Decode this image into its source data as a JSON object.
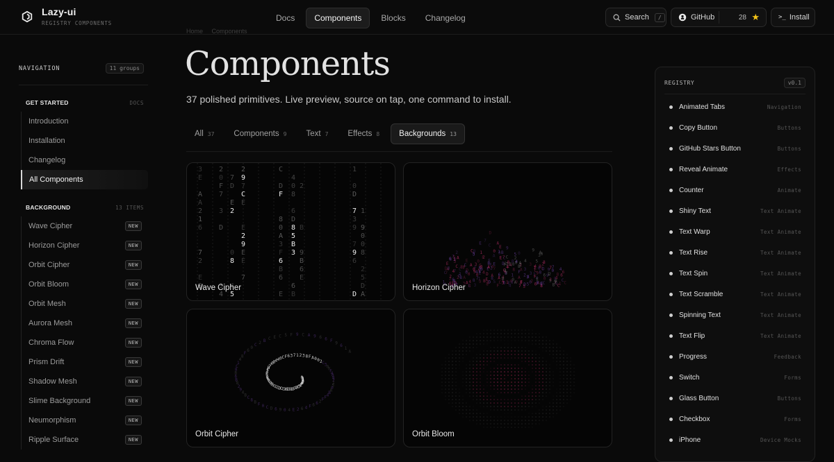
{
  "brand": {
    "name": "Lazy-ui",
    "sub": "REGISTRY COMPONENTS"
  },
  "nav": [
    "Docs",
    "Components",
    "Blocks",
    "Changelog"
  ],
  "header": {
    "search": "Search",
    "search_key": "/",
    "github": "GitHub",
    "stars": "28",
    "install": "Install"
  },
  "sidebar": {
    "title": "NAVIGATION",
    "badge": "11 groups",
    "get_started": {
      "title": "GET STARTED",
      "meta": "DOCS",
      "items": [
        "Introduction",
        "Installation",
        "Changelog",
        "All Components"
      ]
    },
    "background": {
      "title": "BACKGROUND",
      "meta": "13 ITEMS",
      "items": [
        "Wave Cipher",
        "Horizon Cipher",
        "Orbit Cipher",
        "Orbit Bloom",
        "Orbit Mesh",
        "Aurora Mesh",
        "Chroma Flow",
        "Prism Drift",
        "Shadow Mesh",
        "Slime Background",
        "Neumorphism",
        "Ripple Surface"
      ],
      "badge": "NEW"
    }
  },
  "breadcrumb": [
    "Home",
    "Components"
  ],
  "page": {
    "title": "Components",
    "subtitle": "37 polished primitives. Live preview, source on tap, one command to install."
  },
  "tabs": [
    {
      "label": "All",
      "count": "37"
    },
    {
      "label": "Components",
      "count": "9"
    },
    {
      "label": "Text",
      "count": "7"
    },
    {
      "label": "Effects",
      "count": "8"
    },
    {
      "label": "Backgrounds",
      "count": "13"
    }
  ],
  "cards": [
    "Wave Cipher",
    "Horizon Cipher",
    "Orbit Cipher",
    "Orbit Bloom"
  ],
  "registry": {
    "title": "REGISTRY",
    "version": "v0.1",
    "items": [
      {
        "name": "Animated Tabs",
        "cat": "Navigation"
      },
      {
        "name": "Copy Button",
        "cat": "Buttons"
      },
      {
        "name": "GitHub Stars Button",
        "cat": "Buttons"
      },
      {
        "name": "Reveal Animate",
        "cat": "Effects"
      },
      {
        "name": "Counter",
        "cat": "Animate"
      },
      {
        "name": "Shiny Text",
        "cat": "Text Animate"
      },
      {
        "name": "Text Warp",
        "cat": "Text Animate"
      },
      {
        "name": "Text Rise",
        "cat": "Text Animate"
      },
      {
        "name": "Text Spin",
        "cat": "Text Animate"
      },
      {
        "name": "Text Scramble",
        "cat": "Text Animate"
      },
      {
        "name": "Spinning Text",
        "cat": "Text Animate"
      },
      {
        "name": "Text Flip",
        "cat": "Text Animate"
      },
      {
        "name": "Progress",
        "cat": "Feedback"
      },
      {
        "name": "Switch",
        "cat": "Forms"
      },
      {
        "name": "Glass Button",
        "cat": "Buttons"
      },
      {
        "name": "Checkbox",
        "cat": "Forms"
      },
      {
        "name": "iPhone",
        "cat": "Device Mocks"
      }
    ]
  },
  "colors": {
    "accent_star": "#f5c518",
    "glyph_purple": "#6b3fa0",
    "glyph_pink": "#c0306a"
  },
  "icons": [
    "logo-icon",
    "search-icon",
    "github-icon",
    "star-icon",
    "terminal-icon"
  ]
}
